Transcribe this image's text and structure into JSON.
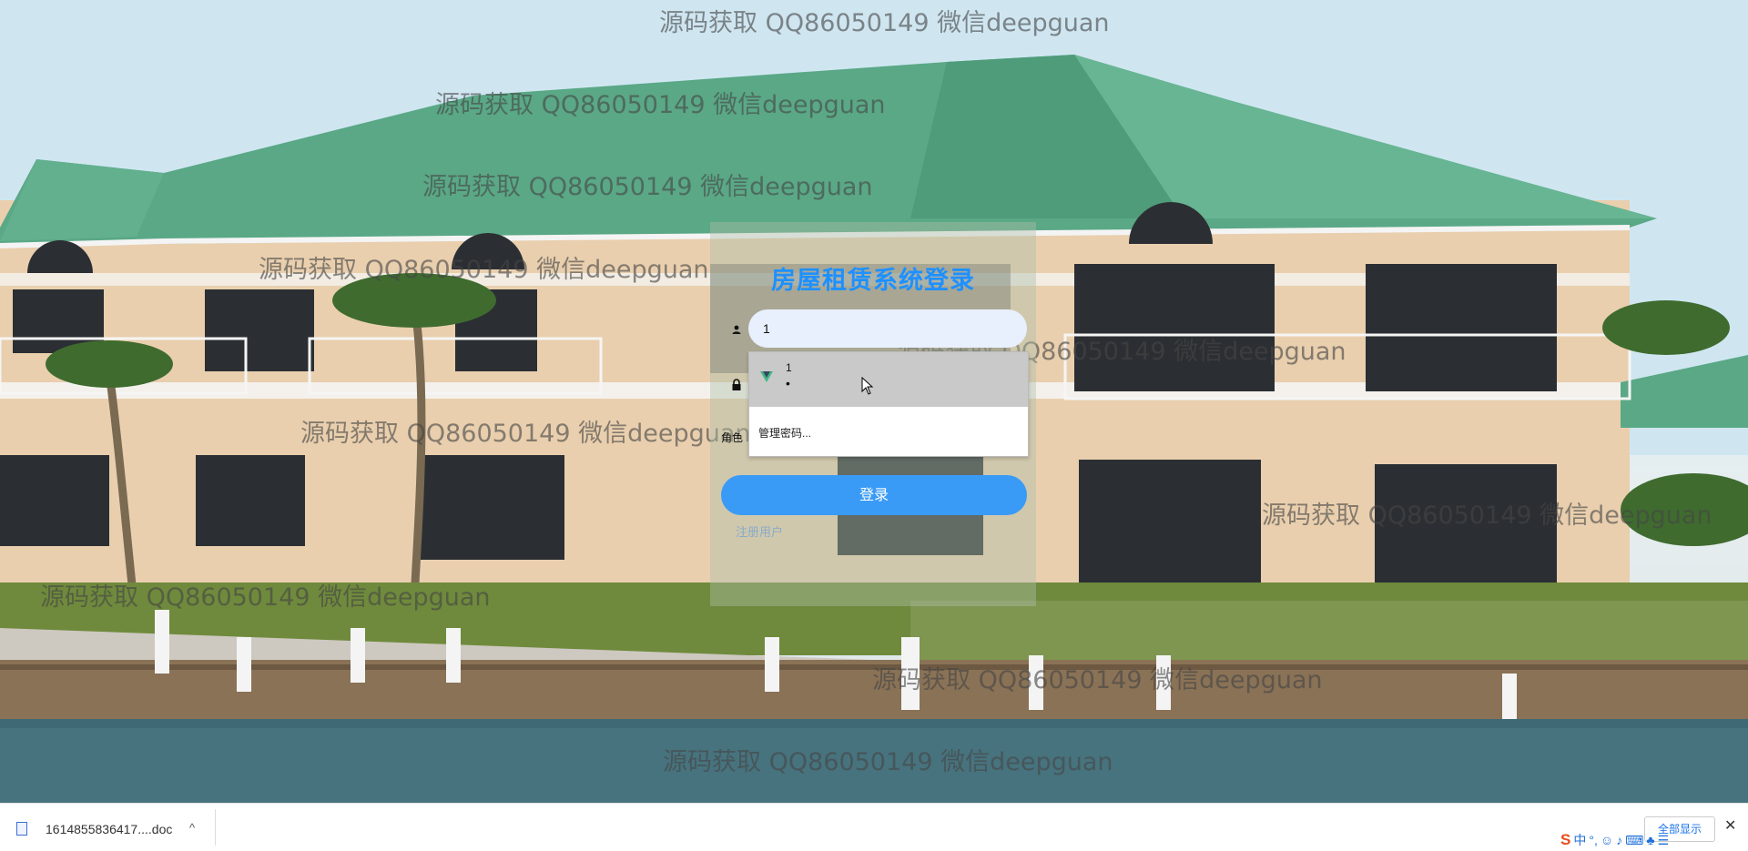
{
  "watermark_text": "源码获取 QQ86050149 微信deepguan",
  "watermark_partial": "源码获取 QQ86050149 微信deepguan",
  "login": {
    "title": "房屋租赁系统登录",
    "username_value": "1",
    "password_value": "•",
    "role_label": "角色",
    "login_button": "登录",
    "register_link": "注册用户"
  },
  "autofill": {
    "username": "1",
    "password_mask": "•",
    "manage_passwords": "管理密码..."
  },
  "download_bar": {
    "file_name": "1614855836417....doc",
    "show_all": "全部显示",
    "close": "✕"
  },
  "ime": {
    "logo": "S",
    "mode": "中"
  },
  "colors": {
    "title": "#1e90ff",
    "login_button": "#3a9bf7",
    "roof": "#5aa886",
    "wall": "#e9cfae"
  }
}
